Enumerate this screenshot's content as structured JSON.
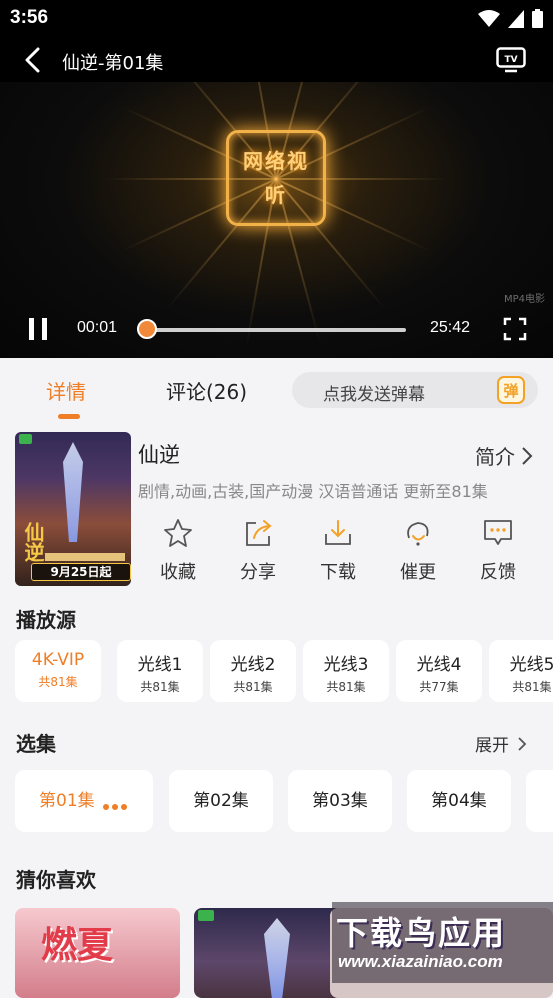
{
  "status_bar": {
    "time": "3:56"
  },
  "header": {
    "title": "仙逆-第01集"
  },
  "player": {
    "current_time": "00:01",
    "duration": "25:42",
    "progress": 0.0,
    "logo_text": "网络视听",
    "watermark": "MP4电影"
  },
  "tabs": [
    {
      "label": "详情",
      "active": true
    },
    {
      "label": "评论(26)",
      "active": false
    }
  ],
  "danmu": {
    "placeholder": "点我发送弹幕",
    "badge": "弹"
  },
  "show": {
    "title": "仙逆",
    "intro_label": "简介",
    "tags": "剧情,动画,古装,国产动漫 汉语普通话 更新至81集",
    "cover_title": "仙逆",
    "cover_date": "9月25日起"
  },
  "actions": [
    {
      "label": "收藏",
      "icon": "star-icon"
    },
    {
      "label": "分享",
      "icon": "share-icon"
    },
    {
      "label": "下载",
      "icon": "download-icon"
    },
    {
      "label": "催更",
      "icon": "remind-icon"
    },
    {
      "label": "反馈",
      "icon": "feedback-icon"
    }
  ],
  "sources_section": {
    "title": "播放源"
  },
  "sources": [
    {
      "name": "4K-VIP",
      "count": "共81集",
      "active": true
    },
    {
      "name": "光线1",
      "count": "共81集",
      "active": false
    },
    {
      "name": "光线2",
      "count": "共81集",
      "active": false
    },
    {
      "name": "光线3",
      "count": "共81集",
      "active": false
    },
    {
      "name": "光线4",
      "count": "共77集",
      "active": false
    },
    {
      "name": "光线5",
      "count": "共81集",
      "active": false
    }
  ],
  "episodes_section": {
    "title": "选集",
    "expand_label": "展开"
  },
  "episodes": [
    {
      "label": "第01集",
      "active": true
    },
    {
      "label": "第02集",
      "active": false
    },
    {
      "label": "第03集",
      "active": false
    },
    {
      "label": "第04集",
      "active": false
    },
    {
      "label": "",
      "active": false
    }
  ],
  "recommend_section": {
    "title": "猜你喜欢"
  },
  "recommend": [
    {
      "poster_text": "燃夏"
    },
    {
      "poster_text": ""
    }
  ],
  "site_watermark": {
    "line1": "下载鸟应用",
    "line2": "www.xiazainiao.com"
  },
  "colors": {
    "accent": "#f07e27",
    "badge": "#f3a127",
    "background": "#f4f4f6"
  }
}
